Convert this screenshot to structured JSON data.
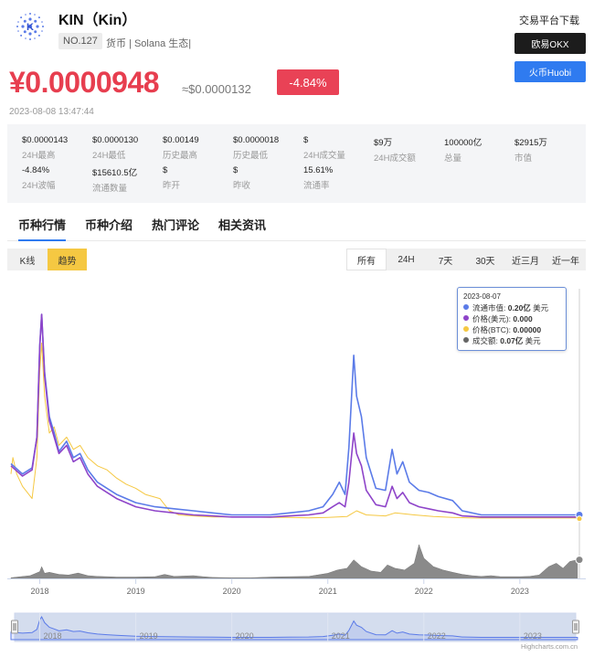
{
  "coin": {
    "name": "KIN（Kin）",
    "rank": "NO.127",
    "tags": "货币 | Solana 生态|"
  },
  "download": {
    "title": "交易平台下载",
    "okx": "欧易OKX",
    "huobi": "火币Huobi",
    "okx_color": "#1c1c1c",
    "huobi_color": "#2f7bf0"
  },
  "price": {
    "cny": "¥0.0000948",
    "usd": "≈$0.0000132",
    "change": "-4.84%",
    "timestamp": "2023-08-08 13:47:44",
    "up_color": "#e73e4f"
  },
  "stats": [
    {
      "value": "$0.0000143",
      "label": "24H最高"
    },
    {
      "value": "$0.0000130",
      "label": "24H最低"
    },
    {
      "value": "$0.00149",
      "label": "历史最高"
    },
    {
      "value": "$0.0000018",
      "label": "历史最低"
    },
    {
      "value": "$",
      "label": "24H成交量"
    },
    {
      "value": "$9万",
      "label": "24H成交额"
    },
    {
      "value": "100000亿",
      "label": "总量"
    },
    {
      "value": "$2915万",
      "label": "市值"
    },
    {
      "value": "-4.84%",
      "label": "24H波幅"
    },
    {
      "value": "$15610.5亿",
      "label": "流通数量"
    },
    {
      "value": "$",
      "label": "昨开"
    },
    {
      "value": "$",
      "label": "昨收"
    },
    {
      "value": "15.61%",
      "label": "流通率"
    }
  ],
  "tabs": [
    "币种行情",
    "币种介绍",
    "热门评论",
    "相关资讯"
  ],
  "modes": [
    "K线",
    "趋势"
  ],
  "ranges": [
    "所有",
    "24H",
    "7天",
    "30天",
    "近三月",
    "近一年"
  ],
  "tooltip": {
    "date": "2023-08-07",
    "rows": [
      {
        "label": "流通市值:",
        "value": "0.20亿",
        "unit": "美元",
        "color": "#5b7be8"
      },
      {
        "label": "价格(美元):",
        "value": "0.000",
        "unit": "",
        "color": "#8e44c9"
      },
      {
        "label": "价格(BTC):",
        "value": "0.00000",
        "unit": "",
        "color": "#f5c842"
      },
      {
        "label": "成交额:",
        "value": "0.07亿",
        "unit": "美元",
        "color": "#666666"
      }
    ]
  },
  "chart_data": {
    "type": "line",
    "x_labels": [
      "2018",
      "2019",
      "2020",
      "2021",
      "2022",
      "2023"
    ],
    "xlim": [
      2017.7,
      2023.62
    ],
    "series": [
      {
        "key": "market_cap",
        "color": "#5b7be8",
        "points": [
          [
            2017.7,
            0.27
          ],
          [
            2017.82,
            0.22
          ],
          [
            2017.92,
            0.25
          ],
          [
            2017.97,
            0.4
          ],
          [
            2018.0,
            0.85
          ],
          [
            2018.02,
            1.0
          ],
          [
            2018.05,
            0.72
          ],
          [
            2018.1,
            0.5
          ],
          [
            2018.15,
            0.42
          ],
          [
            2018.2,
            0.33
          ],
          [
            2018.28,
            0.38
          ],
          [
            2018.35,
            0.3
          ],
          [
            2018.42,
            0.32
          ],
          [
            2018.5,
            0.24
          ],
          [
            2018.6,
            0.18
          ],
          [
            2018.7,
            0.15
          ],
          [
            2018.8,
            0.12
          ],
          [
            2018.9,
            0.1
          ],
          [
            2019.0,
            0.08
          ],
          [
            2019.2,
            0.06
          ],
          [
            2019.4,
            0.05
          ],
          [
            2019.6,
            0.04
          ],
          [
            2019.8,
            0.03
          ],
          [
            2020.0,
            0.02
          ],
          [
            2020.2,
            0.02
          ],
          [
            2020.4,
            0.02
          ],
          [
            2020.6,
            0.03
          ],
          [
            2020.8,
            0.04
          ],
          [
            2020.95,
            0.06
          ],
          [
            2021.05,
            0.12
          ],
          [
            2021.12,
            0.18
          ],
          [
            2021.18,
            0.12
          ],
          [
            2021.22,
            0.35
          ],
          [
            2021.27,
            0.8
          ],
          [
            2021.3,
            0.6
          ],
          [
            2021.35,
            0.5
          ],
          [
            2021.4,
            0.3
          ],
          [
            2021.5,
            0.15
          ],
          [
            2021.6,
            0.14
          ],
          [
            2021.67,
            0.34
          ],
          [
            2021.72,
            0.22
          ],
          [
            2021.78,
            0.28
          ],
          [
            2021.85,
            0.18
          ],
          [
            2021.95,
            0.14
          ],
          [
            2022.05,
            0.13
          ],
          [
            2022.15,
            0.11
          ],
          [
            2022.3,
            0.09
          ],
          [
            2022.4,
            0.04
          ],
          [
            2022.6,
            0.02
          ],
          [
            2022.8,
            0.02
          ],
          [
            2023.0,
            0.02
          ],
          [
            2023.2,
            0.02
          ],
          [
            2023.4,
            0.02
          ],
          [
            2023.6,
            0.02
          ]
        ]
      },
      {
        "key": "price_usd",
        "color": "#8e44c9",
        "points": [
          [
            2017.7,
            0.26
          ],
          [
            2017.82,
            0.21
          ],
          [
            2017.92,
            0.24
          ],
          [
            2017.97,
            0.4
          ],
          [
            2018.0,
            0.84
          ],
          [
            2018.02,
            1.0
          ],
          [
            2018.05,
            0.7
          ],
          [
            2018.1,
            0.48
          ],
          [
            2018.15,
            0.4
          ],
          [
            2018.2,
            0.32
          ],
          [
            2018.28,
            0.36
          ],
          [
            2018.35,
            0.28
          ],
          [
            2018.42,
            0.3
          ],
          [
            2018.5,
            0.22
          ],
          [
            2018.6,
            0.16
          ],
          [
            2018.7,
            0.13
          ],
          [
            2018.8,
            0.1
          ],
          [
            2018.9,
            0.08
          ],
          [
            2019.0,
            0.06
          ],
          [
            2019.2,
            0.04
          ],
          [
            2019.4,
            0.03
          ],
          [
            2019.6,
            0.02
          ],
          [
            2019.8,
            0.015
          ],
          [
            2020.0,
            0.01
          ],
          [
            2020.2,
            0.01
          ],
          [
            2020.4,
            0.01
          ],
          [
            2020.6,
            0.015
          ],
          [
            2020.8,
            0.02
          ],
          [
            2020.95,
            0.03
          ],
          [
            2021.05,
            0.06
          ],
          [
            2021.12,
            0.08
          ],
          [
            2021.18,
            0.06
          ],
          [
            2021.22,
            0.18
          ],
          [
            2021.27,
            0.42
          ],
          [
            2021.3,
            0.32
          ],
          [
            2021.35,
            0.26
          ],
          [
            2021.4,
            0.14
          ],
          [
            2021.5,
            0.07
          ],
          [
            2021.6,
            0.06
          ],
          [
            2021.67,
            0.16
          ],
          [
            2021.72,
            0.1
          ],
          [
            2021.78,
            0.13
          ],
          [
            2021.85,
            0.08
          ],
          [
            2021.95,
            0.06
          ],
          [
            2022.05,
            0.05
          ],
          [
            2022.15,
            0.04
          ],
          [
            2022.3,
            0.03
          ],
          [
            2022.4,
            0.015
          ],
          [
            2022.6,
            0.01
          ],
          [
            2022.8,
            0.01
          ],
          [
            2023.0,
            0.01
          ],
          [
            2023.2,
            0.01
          ],
          [
            2023.4,
            0.01
          ],
          [
            2023.6,
            0.01
          ]
        ]
      },
      {
        "key": "price_btc",
        "color": "#f5c842",
        "points": [
          [
            2017.7,
            0.22
          ],
          [
            2017.72,
            0.3
          ],
          [
            2017.76,
            0.22
          ],
          [
            2017.82,
            0.16
          ],
          [
            2017.92,
            0.1
          ],
          [
            2017.97,
            0.3
          ],
          [
            2018.0,
            0.72
          ],
          [
            2018.02,
            0.86
          ],
          [
            2018.05,
            0.6
          ],
          [
            2018.1,
            0.42
          ],
          [
            2018.15,
            0.45
          ],
          [
            2018.2,
            0.36
          ],
          [
            2018.28,
            0.4
          ],
          [
            2018.35,
            0.34
          ],
          [
            2018.42,
            0.36
          ],
          [
            2018.5,
            0.3
          ],
          [
            2018.6,
            0.26
          ],
          [
            2018.7,
            0.24
          ],
          [
            2018.8,
            0.2
          ],
          [
            2018.9,
            0.17
          ],
          [
            2019.0,
            0.15
          ],
          [
            2019.1,
            0.12
          ],
          [
            2019.25,
            0.1
          ],
          [
            2019.35,
            0.04
          ],
          [
            2019.45,
            0.02
          ],
          [
            2019.6,
            0.015
          ],
          [
            2019.8,
            0.01
          ],
          [
            2020.0,
            0.01
          ],
          [
            2020.2,
            0.01
          ],
          [
            2020.4,
            0.008
          ],
          [
            2020.6,
            0.008
          ],
          [
            2020.8,
            0.006
          ],
          [
            2021.0,
            0.008
          ],
          [
            2021.2,
            0.012
          ],
          [
            2021.3,
            0.04
          ],
          [
            2021.4,
            0.02
          ],
          [
            2021.6,
            0.015
          ],
          [
            2021.7,
            0.03
          ],
          [
            2021.9,
            0.02
          ],
          [
            2022.1,
            0.012
          ],
          [
            2022.3,
            0.008
          ],
          [
            2022.5,
            0.005
          ],
          [
            2022.8,
            0.005
          ],
          [
            2023.0,
            0.005
          ],
          [
            2023.3,
            0.005
          ],
          [
            2023.6,
            0.005
          ]
        ]
      }
    ],
    "volume": [
      [
        2017.7,
        0.02
      ],
      [
        2017.8,
        0.05
      ],
      [
        2017.9,
        0.08
      ],
      [
        2018.0,
        0.2
      ],
      [
        2018.02,
        0.35
      ],
      [
        2018.05,
        0.15
      ],
      [
        2018.1,
        0.18
      ],
      [
        2018.2,
        0.12
      ],
      [
        2018.3,
        0.1
      ],
      [
        2018.4,
        0.16
      ],
      [
        2018.5,
        0.08
      ],
      [
        2018.6,
        0.06
      ],
      [
        2018.7,
        0.05
      ],
      [
        2018.8,
        0.04
      ],
      [
        2018.9,
        0.04
      ],
      [
        2019.0,
        0.04
      ],
      [
        2019.2,
        0.05
      ],
      [
        2019.3,
        0.12
      ],
      [
        2019.4,
        0.06
      ],
      [
        2019.5,
        0.07
      ],
      [
        2019.6,
        0.08
      ],
      [
        2019.7,
        0.05
      ],
      [
        2019.8,
        0.03
      ],
      [
        2020.0,
        0.02
      ],
      [
        2020.2,
        0.02
      ],
      [
        2020.4,
        0.04
      ],
      [
        2020.6,
        0.05
      ],
      [
        2020.8,
        0.06
      ],
      [
        2021.0,
        0.15
      ],
      [
        2021.1,
        0.25
      ],
      [
        2021.2,
        0.3
      ],
      [
        2021.27,
        0.55
      ],
      [
        2021.35,
        0.35
      ],
      [
        2021.45,
        0.22
      ],
      [
        2021.55,
        0.18
      ],
      [
        2021.62,
        0.4
      ],
      [
        2021.7,
        0.3
      ],
      [
        2021.8,
        0.25
      ],
      [
        2021.9,
        0.45
      ],
      [
        2021.95,
        1.0
      ],
      [
        2022.0,
        0.6
      ],
      [
        2022.1,
        0.35
      ],
      [
        2022.2,
        0.25
      ],
      [
        2022.3,
        0.18
      ],
      [
        2022.4,
        0.12
      ],
      [
        2022.5,
        0.08
      ],
      [
        2022.6,
        0.06
      ],
      [
        2022.7,
        0.08
      ],
      [
        2022.8,
        0.05
      ],
      [
        2022.9,
        0.05
      ],
      [
        2023.0,
        0.05
      ],
      [
        2023.1,
        0.06
      ],
      [
        2023.2,
        0.1
      ],
      [
        2023.3,
        0.35
      ],
      [
        2023.38,
        0.45
      ],
      [
        2023.45,
        0.3
      ],
      [
        2023.52,
        0.5
      ],
      [
        2023.6,
        0.55
      ]
    ],
    "navigator": {
      "color": "#5b7be8"
    }
  },
  "credits": "Highcharts.com.cn"
}
